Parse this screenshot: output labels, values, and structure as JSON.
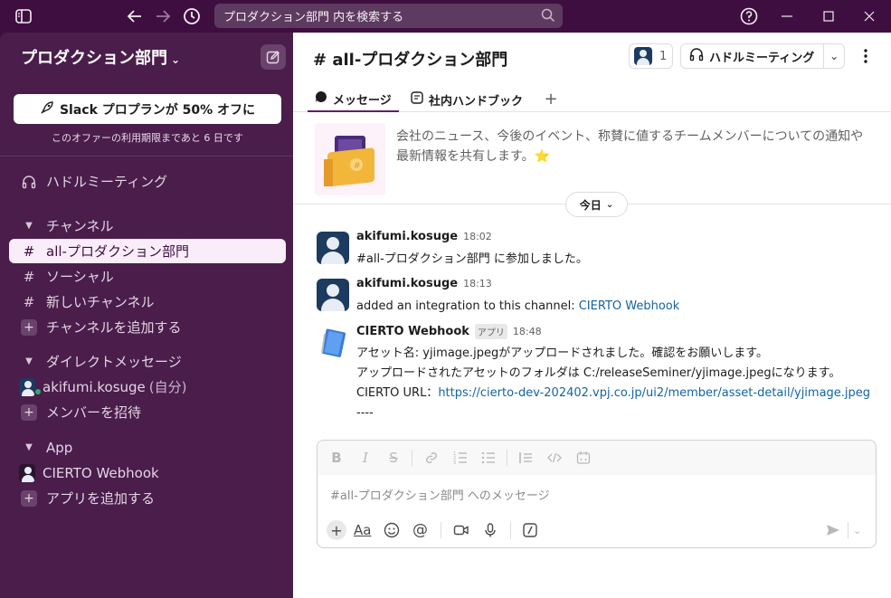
{
  "titlebar": {
    "search_placeholder": "プロダクション部門 内を検索する"
  },
  "sidebar": {
    "workspace_name": "プロダクション部門",
    "promo_label": "Slack プロプランが 50% オフに",
    "promo_sub": "このオファーの利用期限まであと 6 日です",
    "huddle": "ハドルミーティング",
    "channels_header": "チャンネル",
    "channels": [
      "all-プロダクション部門",
      "ソーシャル",
      "新しいチャンネル"
    ],
    "add_channel": "チャンネルを追加する",
    "dm_header": "ダイレクトメッセージ",
    "dm_user": "akifumi.kosuge",
    "dm_self": "(自分)",
    "invite": "メンバーを招待",
    "app_header": "App",
    "app_item": "CIERTO Webhook",
    "add_app": "アプリを追加する"
  },
  "main": {
    "channel_title": "# all-プロダクション部門",
    "member_count": "1",
    "huddle_label": "ハドルミーティング",
    "tabs": [
      "メッセージ",
      "社内ハンドブック"
    ],
    "intro": "会社のニュース、今後のイベント、称賛に値するチームメンバーについての通知や最新情報を共有します。⭐",
    "day_label": "今日",
    "messages": [
      {
        "name": "akifumi.kosuge",
        "time": "18:02",
        "body": "#all-プロダクション部門 に参加しました。"
      },
      {
        "name": "akifumi.kosuge",
        "time": "18:13",
        "body_prefix": "added an integration to this channel: ",
        "body_link": "CIERTO Webhook"
      },
      {
        "name": "CIERTO Webhook",
        "tag": "アプリ",
        "time": "18:48",
        "line1": "アセット名: yjimage.jpegがアップロードされました。確認をお願いします。",
        "line2": "アップロードされたアセットのフォルダは C:/releaseSeminer/yjimage.jpegになります。",
        "line3_prefix": "CIERTO URL：",
        "line3_link": "https://cierto-dev-202402.vpj.co.jp/ui2/member/asset-detail/yjimage.jpeg",
        "line4": "----"
      }
    ],
    "composer_placeholder": "#all-プロダクション部門 へのメッセージ"
  },
  "colors": {
    "aubergine": "#3f0e40",
    "sidebar": "#4a1d4b",
    "link": "#1264a3",
    "active_tab": "#611f69"
  }
}
